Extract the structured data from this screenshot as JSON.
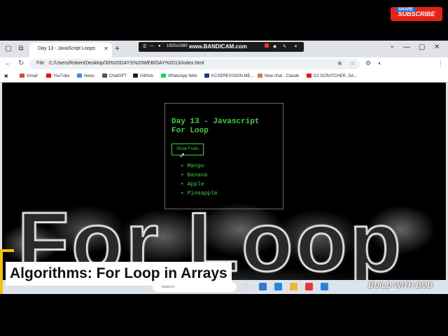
{
  "recording_bar": {
    "resolution": "1920x1080",
    "logo": "www.BANDICAM.com"
  },
  "browser": {
    "tab_title": "Day 13 - JavaScript Loops",
    "new_tab": "+",
    "address": {
      "scheme_label": "File",
      "url": "C:/Users/Robert/Desktop/30%20DAYS%20WEB/DAY%2013/index.html"
    },
    "bookmarks": [
      {
        "label": "Gmail",
        "color": "#ea4335"
      },
      {
        "label": "YouTube",
        "color": "#ff0000"
      },
      {
        "label": "News",
        "color": "#4285f4"
      },
      {
        "label": "ChatGPT",
        "color": "#555555"
      },
      {
        "label": "GitHub",
        "color": "#222222"
      },
      {
        "label": "WhatsApp Web",
        "color": "#25d366"
      },
      {
        "label": "KCSEREVISION.ME...",
        "color": "#1a3a8a"
      },
      {
        "label": "New chat - Claude",
        "color": "#d97757"
      },
      {
        "label": "DJ SCRATCHER, DA...",
        "color": "#ff0000"
      }
    ]
  },
  "page": {
    "heading": "Day 13 - Javascript For Loop",
    "button_label": "Show Fruits",
    "fruits": [
      "Mango",
      "Banana",
      "Apple",
      "Pineapple"
    ]
  },
  "overlay": {
    "big_text": "For Loop",
    "caption": "Algorithms: For Loop in Arrays",
    "subscribe": "SUBSCRIBE",
    "share": "SHARE",
    "brand": "BUILD WITH BOB"
  },
  "taskbar": {
    "search_placeholder": "Search"
  },
  "colors": {
    "accent_green": "#3ecf3e",
    "subscribe_red": "#e62117",
    "caption_yellow": "#f5c400"
  }
}
